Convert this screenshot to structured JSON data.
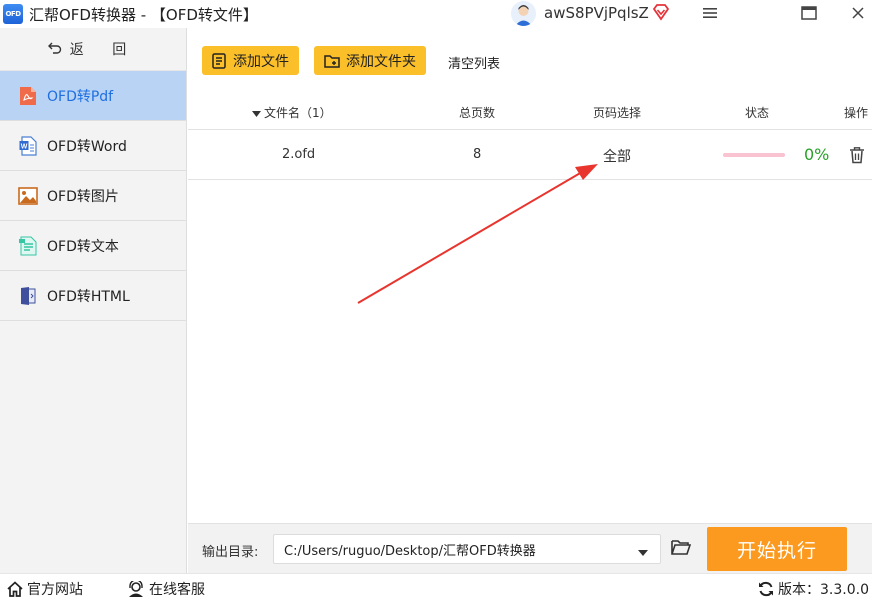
{
  "window": {
    "logo_text": "OFD",
    "title": "汇帮OFD转换器 - 【OFD转文件】",
    "username": "awS8PVjPqlsZ"
  },
  "sidebar": {
    "back_label": "返 回",
    "items": [
      {
        "label": "OFD转Pdf",
        "icon": "pdf-icon",
        "active": true
      },
      {
        "label": "OFD转Word",
        "icon": "word-icon",
        "active": false
      },
      {
        "label": "OFD转图片",
        "icon": "image-icon",
        "active": false
      },
      {
        "label": "OFD转文本",
        "icon": "text-icon",
        "active": false
      },
      {
        "label": "OFD转HTML",
        "icon": "html-icon",
        "active": false
      }
    ]
  },
  "toolbar": {
    "add_file": "添加文件",
    "add_folder": "添加文件夹",
    "clear_list": "清空列表"
  },
  "table": {
    "headers": {
      "name": "文件名（1）",
      "pages": "总页数",
      "range": "页码选择",
      "status": "状态",
      "action": "操作"
    },
    "rows": [
      {
        "name": "2.ofd",
        "pages": "8",
        "range": "全部",
        "progress": 0,
        "percent": "0%"
      }
    ]
  },
  "output": {
    "label": "输出目录:",
    "path": "C:/Users/ruguo/Desktop/汇帮OFD转换器",
    "start_button": "开始执行"
  },
  "footer": {
    "site": "官方网站",
    "service": "在线客服",
    "version": "版本：3.3.0.0"
  },
  "colors": {
    "accent_blue": "#1e6fe0",
    "sidebar_active": "#b9d3f5",
    "button_yellow": "#fbbf2a",
    "start_orange": "#fb9a1f",
    "percent_green": "#2aa12a",
    "annotation_red": "#e8352e"
  }
}
